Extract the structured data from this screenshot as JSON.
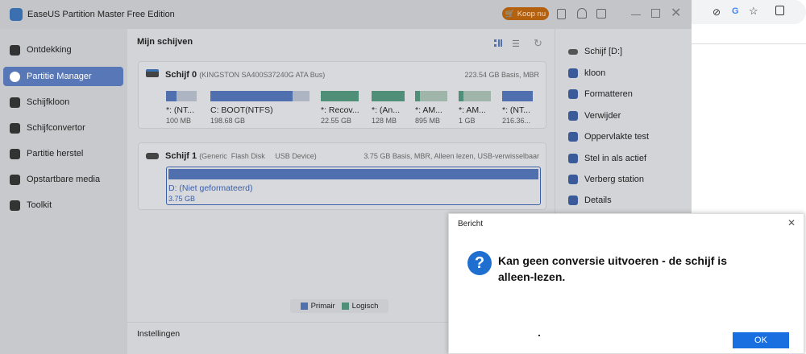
{
  "app": {
    "title": "EaseUS Partition Master Free Edition",
    "buy_label": "Koop nu"
  },
  "sidebar": {
    "items": [
      {
        "label": "Ontdekking"
      },
      {
        "label": "Partitie Manager"
      },
      {
        "label": "Schijfkloon"
      },
      {
        "label": "Schijfconvertor"
      },
      {
        "label": "Partitie herstel"
      },
      {
        "label": "Opstartbare media"
      },
      {
        "label": "Toolkit"
      }
    ]
  },
  "main": {
    "title": "Mijn schijven",
    "settings": "Instellingen",
    "disk0": {
      "name": "Schijf 0",
      "model": "(KINGSTON SA400S37240G ATA Bus)",
      "info": "223.54 GB Basis, MBR",
      "partitions": [
        {
          "name": "*: (NT...",
          "size": "100 MB",
          "used": 0.35,
          "type": "p"
        },
        {
          "name": "C: BOOT(NTFS)",
          "size": "198.68 GB",
          "used": 0.83,
          "type": "p"
        },
        {
          "name": "*: Recov...",
          "size": "22.55 GB",
          "used": 1,
          "type": "g"
        },
        {
          "name": "*: (An...",
          "size": "128 MB",
          "used": 1,
          "type": "g"
        },
        {
          "name": "*: AM...",
          "size": "895 MB",
          "used": 0.15,
          "type": "g"
        },
        {
          "name": "*: AM...",
          "size": "1 GB",
          "used": 0.15,
          "type": "g"
        },
        {
          "name": "*: (NT...",
          "size": "216.36...",
          "used": 1,
          "type": "p"
        }
      ]
    },
    "disk1": {
      "name": "Schijf 1",
      "model": "(Generic  Flash Disk     USB Device)",
      "info": "3.75 GB Basis, MBR, Alleen lezen, USB-verwisselbaar",
      "partition": {
        "name": "D: (Niet geformateerd)",
        "size": "3.75 GB"
      }
    },
    "legend": {
      "primary": "Primair",
      "logical": "Logisch"
    }
  },
  "right": {
    "disk": "Schijf [D:]",
    "actions": [
      "kloon",
      "Formatteren",
      "Verwijder",
      "Oppervlakte test",
      "Stel in als actief",
      "Verberg station",
      "Details"
    ]
  },
  "dialog": {
    "title": "Bericht",
    "message": "Kan geen conversie uitvoeren - de schijf is alleen-lezen.",
    "ok": "OK"
  },
  "colors": {
    "primary": "#4f6fae",
    "logical": "#4f8f77",
    "accent": "#c0600a",
    "ok": "#1a6fe0"
  }
}
